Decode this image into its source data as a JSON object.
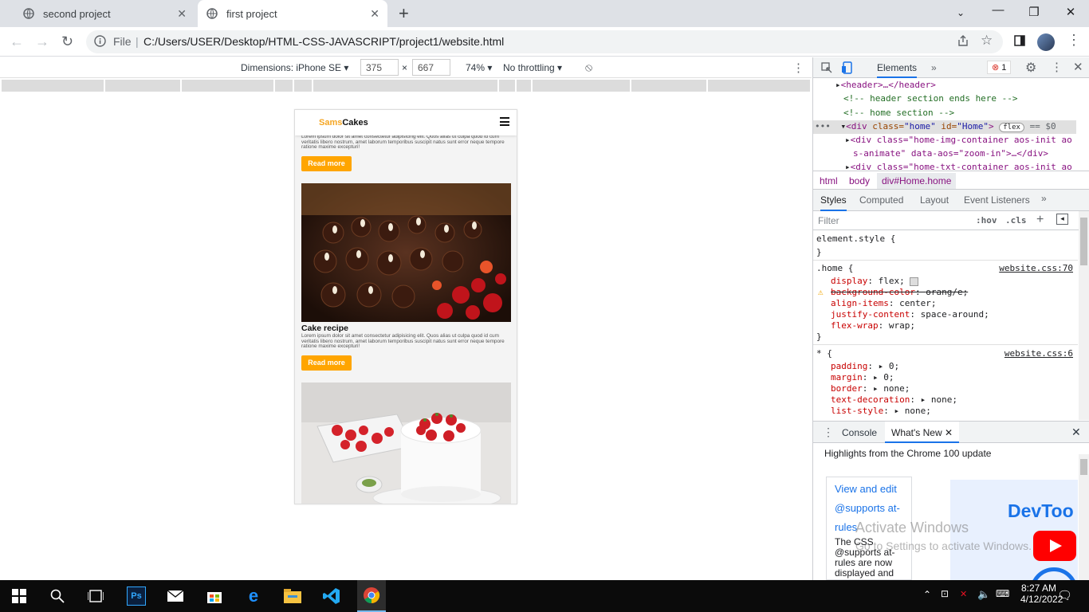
{
  "browser": {
    "tabs": [
      {
        "title": "second project",
        "active": false
      },
      {
        "title": "first project",
        "active": true
      }
    ],
    "new_tab": "+",
    "address": {
      "scheme_label": "File",
      "url": "C:/Users/USER/Desktop/HTML-CSS-JAVASCRIPT/project1/website.html"
    }
  },
  "device_toolbar": {
    "dimensions_label": "Dimensions: iPhone SE",
    "width": "375",
    "times": "×",
    "height": "667",
    "zoom": "74%",
    "throttling": "No throttling"
  },
  "site": {
    "logo_part1": "Sams",
    "logo_part2": "Cakes",
    "lorem": "Lorem ipsum dolor sit amet consectetur adipisicing elit. Quos alias ut culpa quod id cum veritatis libero nostrum, amet laborum temporibus suscipit natus sunt error neque tempore ratione maxime excepturi!",
    "read_more": "Read more",
    "post_title": "Cake recipe"
  },
  "devtools": {
    "panel_tab": "Elements",
    "error_count": "1",
    "dom_lines": [
      {
        "kind": "tag",
        "text": "<header>…</header>"
      },
      {
        "kind": "comment",
        "text": "<!-- header section ends here -->"
      },
      {
        "kind": "comment",
        "text": "<!-- home section -->"
      },
      {
        "kind": "selected",
        "tag": "<div ",
        "a1": "class=",
        "v1": "\"home\"",
        "a2": " id=",
        "v2": "\"Home\"",
        "close": ">",
        "badge": "flex",
        "eq": "== $0"
      },
      {
        "kind": "tag",
        "text": "<div class=\"home-img-container aos-init ao"
      },
      {
        "kind": "tag",
        "text": "s-animate\" data-aos=\"zoom-in\">…</div>"
      },
      {
        "kind": "tag",
        "text": "<div class=\"home-txt-container aos-init ao"
      }
    ],
    "breadcrumbs": [
      "html",
      "body",
      "div#Home.home"
    ],
    "style_tabs": [
      "Styles",
      "Computed",
      "Layout",
      "Event Listeners"
    ],
    "filter_placeholder": "Filter",
    "hov": ":hov",
    "cls": ".cls",
    "rules": {
      "element_style": "element.style {",
      "close": "}",
      "home_selector": ".home {",
      "home_source": "website.css:70",
      "home_props": [
        {
          "name": "display",
          "value": "flex;"
        },
        {
          "name": "background-color",
          "value": "orang/e;"
        },
        {
          "name": "align-items",
          "value": "center;"
        },
        {
          "name": "justify-content",
          "value": "space-around;"
        },
        {
          "name": "flex-wrap",
          "value": "wrap;"
        }
      ],
      "star_selector": "* {",
      "star_source": "website.css:6",
      "star_props": [
        {
          "name": "padding",
          "value": "0;"
        },
        {
          "name": "margin",
          "value": "0;"
        },
        {
          "name": "border",
          "value": "none;"
        },
        {
          "name": "text-decoration",
          "value": "none;"
        },
        {
          "name": "list-style",
          "value": "none;"
        }
      ]
    },
    "drawer_tabs": [
      "Console",
      "What's New"
    ],
    "whats_new_header": "Highlights from the Chrome 100 update",
    "card_link": "View and edit @supports at-rules",
    "card_text": "The CSS @supports at-rules are now displayed and editable in the",
    "devtools_logo_text": "DevToo"
  },
  "os": {
    "watermark_title": "Activate Windows",
    "watermark_sub": "Go to Settings to activate Windows.",
    "time": "8:27 AM",
    "date": "4/12/2022"
  },
  "colors": {
    "accent_orange": "#ffa500",
    "chrome_tab_strip": "#dee1e6",
    "taskbar": "#0b0b0b"
  }
}
